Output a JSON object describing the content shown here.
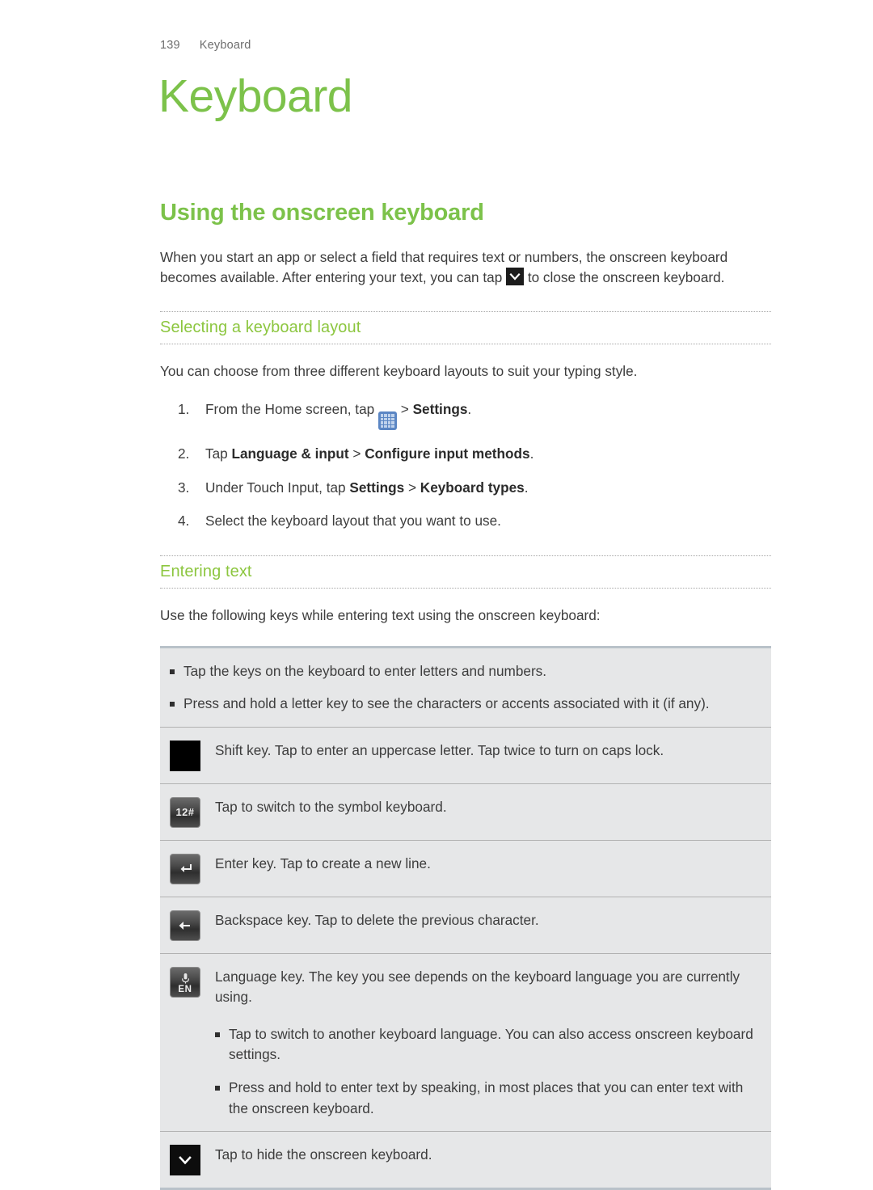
{
  "header": {
    "page_number": "139",
    "chapter_label": "Keyboard"
  },
  "chapter_title": "Keyboard",
  "section": {
    "title": "Using the onscreen keyboard",
    "intro_part1": "When you start an app or select a field that requires text or numbers, the onscreen keyboard becomes available. After entering your text, you can tap",
    "intro_part2": "to close the onscreen keyboard.",
    "inline_icon": "chevron-down-key-icon"
  },
  "subsection_layout": {
    "title": "Selecting a keyboard layout",
    "intro": "You can choose from three different keyboard layouts to suit your typing style.",
    "steps": [
      {
        "num": "1.",
        "text_before": "From the Home screen, tap",
        "icon": "app-grid-icon",
        "text_after_plain": " > ",
        "bold1": "Settings",
        "text_tail": "."
      },
      {
        "num": "2.",
        "text_before": "Tap ",
        "bold1": "Language & input",
        "mid": " > ",
        "bold2": "Configure input methods",
        "text_tail": "."
      },
      {
        "num": "3.",
        "text_before": "Under Touch Input, tap ",
        "bold1": "Settings",
        "mid": " > ",
        "bold2": "Keyboard types",
        "text_tail": "."
      },
      {
        "num": "4.",
        "text_before": "Select the keyboard layout that you want to use."
      }
    ]
  },
  "subsection_entering": {
    "title": "Entering text",
    "intro": "Use the following keys while entering text using the onscreen keyboard:"
  },
  "key_table": {
    "rows": [
      {
        "icon": null,
        "bullets": [
          "Tap the keys on the keyboard to enter letters and numbers.",
          "Press and hold a letter key to see the characters or accents associated with it (if any)."
        ]
      },
      {
        "icon": "shift-key-icon",
        "icon_label": "",
        "text": "Shift key. Tap to enter an uppercase letter. Tap twice to turn on caps lock."
      },
      {
        "icon": "symbol-key-icon",
        "icon_label": "12#",
        "text": "Tap to switch to the symbol keyboard."
      },
      {
        "icon": "enter-key-icon",
        "icon_label": "",
        "text": "Enter key. Tap to create a new line."
      },
      {
        "icon": "backspace-key-icon",
        "icon_label": "",
        "text": "Backspace key. Tap to delete the previous character."
      },
      {
        "icon": "language-key-icon",
        "icon_label": "EN",
        "text": "Language key. The key you see depends on the keyboard language you are currently using.",
        "bullets": [
          "Tap to switch to another keyboard language. You can also access onscreen keyboard settings.",
          "Press and hold to enter text by speaking, in most places that you can enter text with the onscreen keyboard."
        ]
      },
      {
        "icon": "hide-keyboard-key-icon",
        "icon_label": "",
        "text": "Tap to hide the onscreen keyboard."
      }
    ]
  },
  "colors": {
    "accent_green": "#7cc24a",
    "subheading_green": "#8cc63f",
    "body_text": "#3d3d3d",
    "table_bg": "#e6e7e8",
    "table_edge": "#b9c2c9",
    "app_grid_blue": "#5b86c4"
  }
}
